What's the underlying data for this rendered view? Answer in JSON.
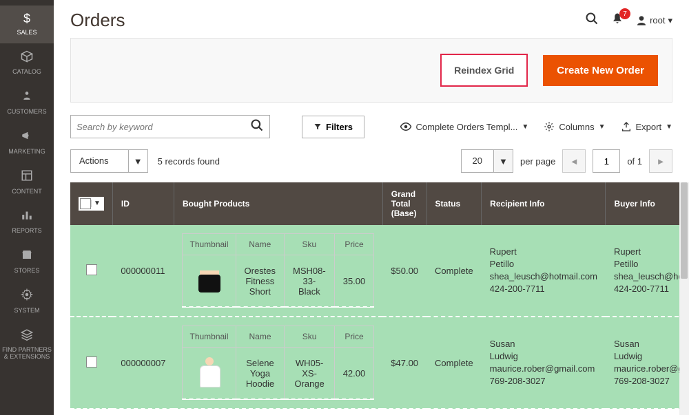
{
  "sidebar": {
    "items": [
      {
        "label": "SALES",
        "icon": "$"
      },
      {
        "label": "CATALOG",
        "icon": "cube"
      },
      {
        "label": "CUSTOMERS",
        "icon": "person"
      },
      {
        "label": "MARKETING",
        "icon": "megaphone"
      },
      {
        "label": "CONTENT",
        "icon": "layout"
      },
      {
        "label": "REPORTS",
        "icon": "bars"
      },
      {
        "label": "STORES",
        "icon": "storefront"
      },
      {
        "label": "SYSTEM",
        "icon": "gear"
      },
      {
        "label": "FIND PARTNERS & EXTENSIONS",
        "icon": "stack"
      }
    ]
  },
  "header": {
    "title": "Orders",
    "notifications": "7",
    "user": "root"
  },
  "actions": {
    "reindex": "Reindex Grid",
    "create": "Create New Order"
  },
  "toolbar": {
    "search_placeholder": "Search by keyword",
    "filters": "Filters",
    "view_label": "Complete Orders Templ...",
    "columns": "Columns",
    "export": "Export"
  },
  "row2": {
    "actions": "Actions",
    "records": "5 records found",
    "page_size": "20",
    "per_page": "per page",
    "page": "1",
    "of": "of 1"
  },
  "grid": {
    "headers": {
      "id": "ID",
      "products": "Bought Products",
      "total": "Grand Total (Base)",
      "status": "Status",
      "recipient": "Recipient Info",
      "buyer": "Buyer Info"
    },
    "inner_headers": {
      "thumb": "Thumbnail",
      "name": "Name",
      "sku": "Sku",
      "price": "Price"
    },
    "rows": [
      {
        "id": "000000011",
        "products": [
          {
            "thumb_class": "short",
            "name": "Orestes Fitness Short",
            "sku": "MSH08-33-Black",
            "price": "35.00"
          }
        ],
        "total": "$50.00",
        "status": "Complete",
        "recipient": {
          "first": "Rupert",
          "last": "Petillo",
          "email": "shea_leusch@hotmail.com",
          "phone": "424-200-7711"
        },
        "buyer": {
          "first": "Rupert",
          "last": "Petillo",
          "email": "shea_leusch@hotmail.",
          "phone": "424-200-7711"
        }
      },
      {
        "id": "000000007",
        "products": [
          {
            "thumb_class": "hoodie",
            "name": "Selene Yoga Hoodie",
            "sku": "WH05-XS-Orange",
            "price": "42.00"
          }
        ],
        "total": "$47.00",
        "status": "Complete",
        "recipient": {
          "first": "Susan",
          "last": "Ludwig",
          "email": "maurice.rober@gmail.com",
          "phone": "769-208-3027"
        },
        "buyer": {
          "first": "Susan",
          "last": "Ludwig",
          "email": "maurice.rober@gmail.",
          "phone": "769-208-3027"
        }
      }
    ]
  }
}
